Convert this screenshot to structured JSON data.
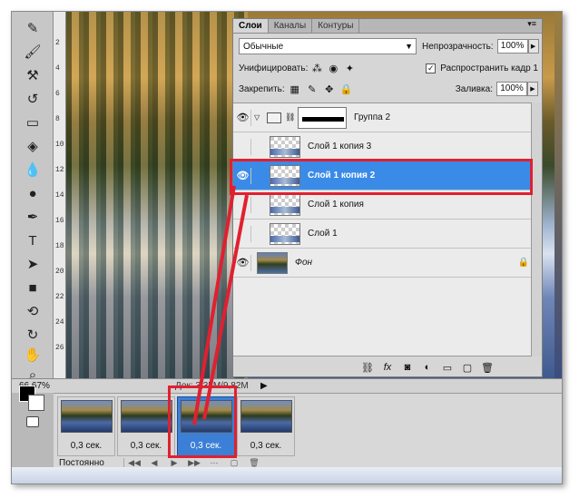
{
  "layers_panel": {
    "tabs": [
      {
        "label": "Слои"
      },
      {
        "label": "Каналы"
      },
      {
        "label": "Контуры"
      }
    ],
    "tab_menu_icon": "panel-menu-icon",
    "blend_mode": "Обычные",
    "opacity_label": "Непрозрачность:",
    "opacity_value": "100%",
    "unify_label": "Унифицировать:",
    "propagate_label": "Распространить кадр 1",
    "propagate_checked": true,
    "lock_label": "Закрепить:",
    "fill_label": "Заливка:",
    "fill_value": "100%",
    "layers": [
      {
        "name": "Группа 2",
        "type": "group",
        "visible": true
      },
      {
        "name": "Слой 1 копия 3",
        "type": "layer",
        "visible": false
      },
      {
        "name": "Слой 1 копия 2",
        "type": "layer",
        "visible": true,
        "selected": true
      },
      {
        "name": "Слой 1 копия",
        "type": "layer",
        "visible": false
      },
      {
        "name": "Слой 1",
        "type": "layer",
        "visible": false
      },
      {
        "name": "Фон",
        "type": "background",
        "visible": true,
        "locked": true
      }
    ]
  },
  "status_bar": {
    "zoom": "66,67%",
    "doc_info": "Док: 3,35М/9,82М"
  },
  "timeline": {
    "frames": [
      {
        "delay": "0,3 сек."
      },
      {
        "delay": "0,3 сек."
      },
      {
        "delay": "0,3 сек.",
        "selected": true
      },
      {
        "delay": "0,3 сек."
      }
    ],
    "loop": "Постоянно"
  },
  "ruler_ticks": [
    "2",
    "4",
    "6",
    "8",
    "10",
    "12",
    "14",
    "16",
    "18",
    "20",
    "22",
    "24",
    "26"
  ],
  "colors": {
    "highlight": "#e02030",
    "selection": "#3a8be8"
  }
}
